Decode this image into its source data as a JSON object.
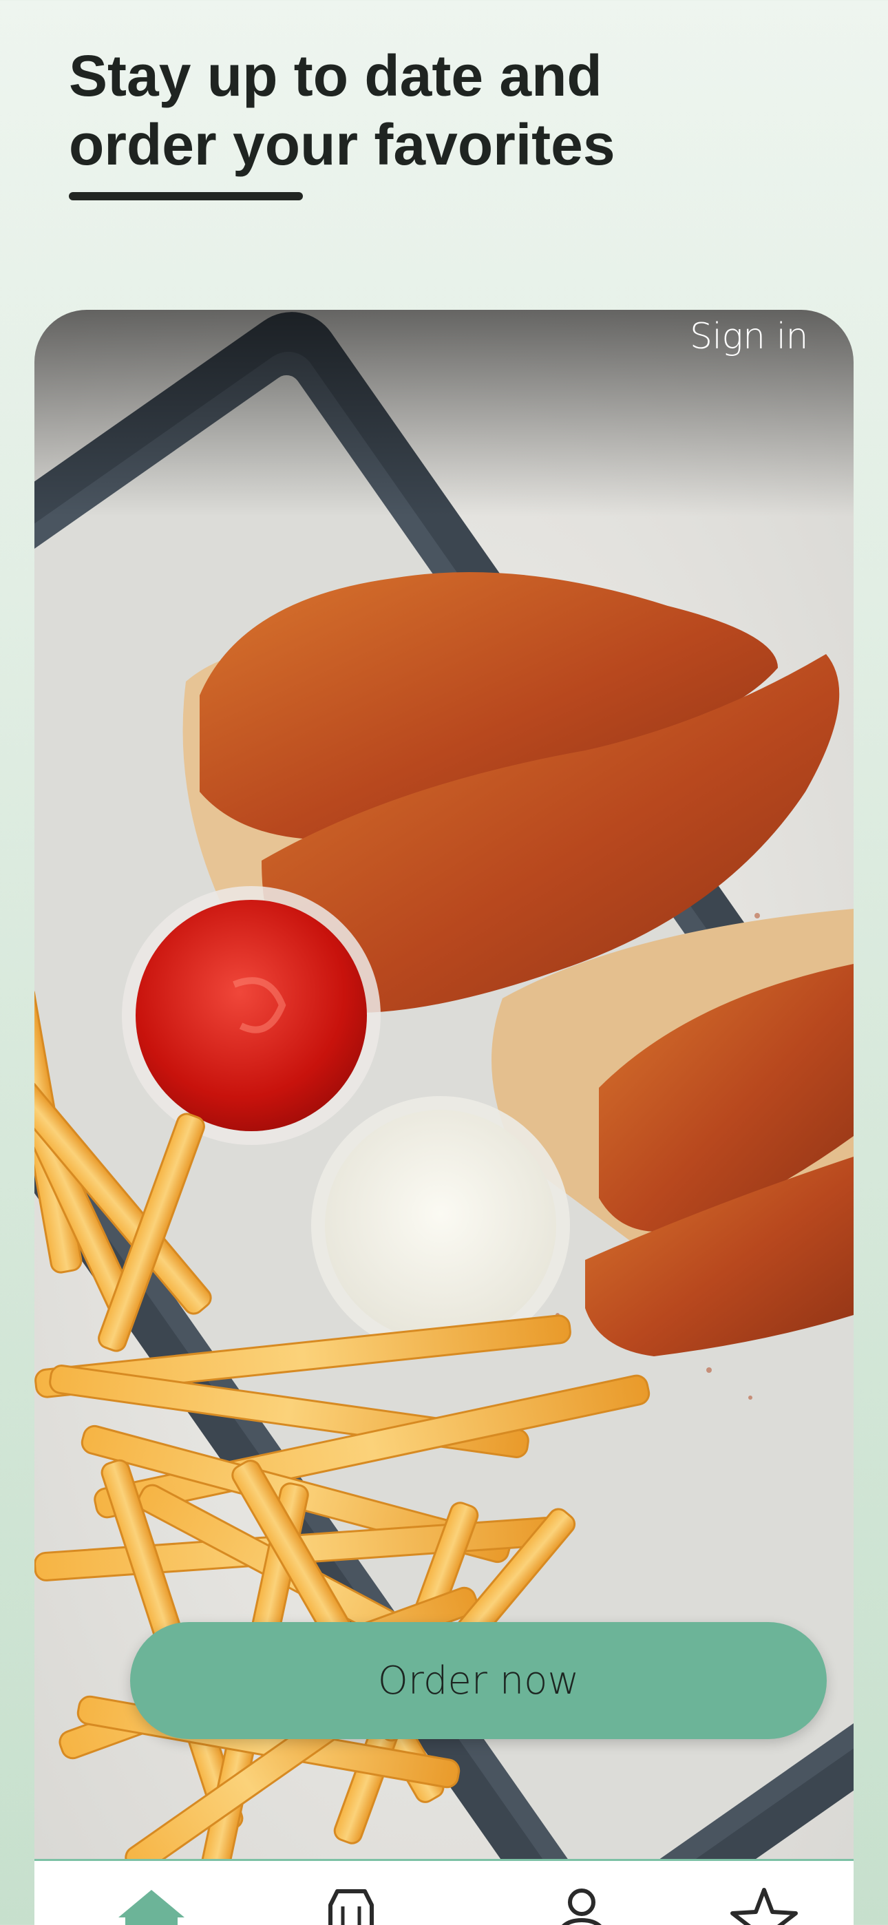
{
  "header": {
    "title_line_1": "Stay up to date and",
    "title_line_2": "order your favorites"
  },
  "hero": {
    "signin_label": "Sign in",
    "order_button_label": "Order now"
  },
  "tab_bar": {
    "tabs": [
      {
        "icon": "home-icon",
        "active": true
      },
      {
        "icon": "menu-bag-icon",
        "active": false
      },
      {
        "icon": "user-icon",
        "active": false
      },
      {
        "icon": "star-icon",
        "active": false
      }
    ]
  },
  "colors": {
    "accent": "#6cb498",
    "title_text": "#1f2421",
    "background_top": "#eef5ef",
    "background_bottom": "#c7e0cd",
    "active_tab": "#6cb498",
    "inactive_tab": "#2a2a2a"
  }
}
